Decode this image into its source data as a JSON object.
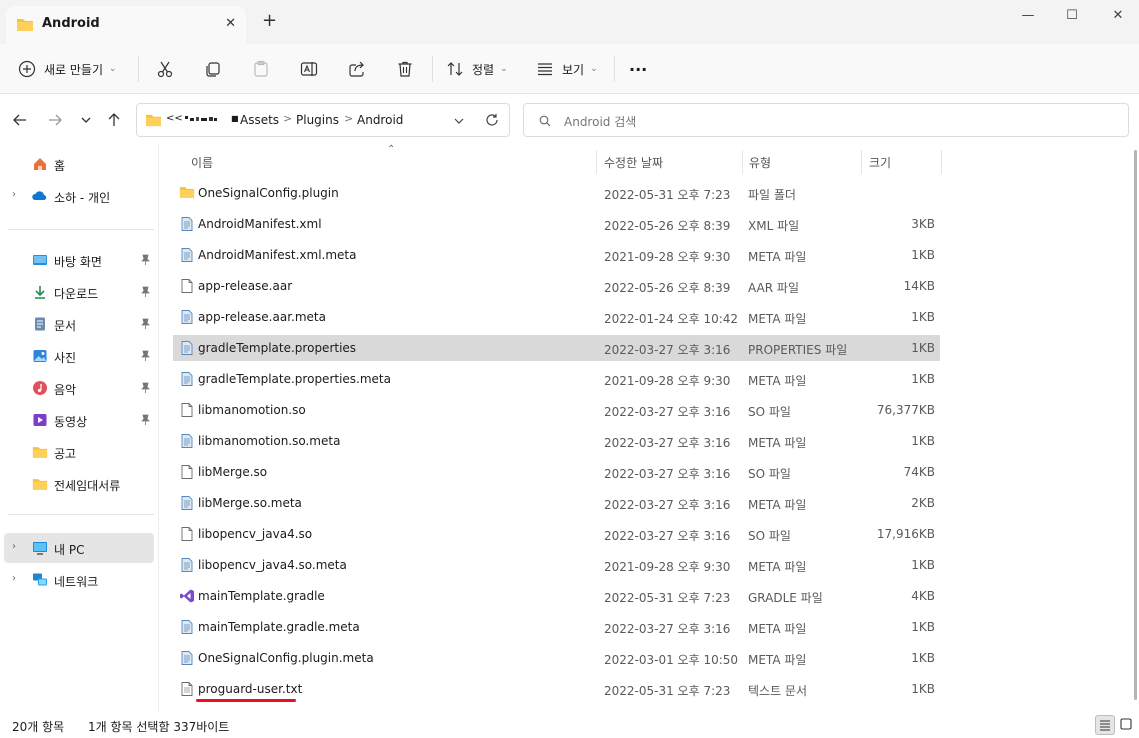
{
  "window": {
    "tab_title": "Android",
    "new_tab": "+",
    "minimize": "—",
    "maximize": "☐",
    "close": "✕",
    "tab_close": "✕"
  },
  "toolbar": {
    "new_label": "새로 만들기",
    "sort_label": "정렬",
    "view_label": "보기",
    "more": "···",
    "icons": [
      "plus-circle-icon",
      "cut-icon",
      "copy-icon",
      "paste-icon",
      "rename-icon",
      "share-icon",
      "delete-icon",
      "sort-icon",
      "view-icon"
    ]
  },
  "address": {
    "crumbs": [
      "<<",
      "Assets",
      "Plugins",
      "Android"
    ],
    "separator": ">",
    "search_placeholder": "Android 검색"
  },
  "sidebar": {
    "items": [
      {
        "label": "홈",
        "icon": "home-icon",
        "expandable": false,
        "pinned": false
      },
      {
        "label": "소하 - 개인",
        "icon": "onedrive-icon",
        "expandable": true,
        "pinned": false
      },
      {
        "label": "바탕 화면",
        "icon": "desktop-icon",
        "expandable": false,
        "pinned": true
      },
      {
        "label": "다운로드",
        "icon": "download-icon",
        "expandable": false,
        "pinned": true
      },
      {
        "label": "문서",
        "icon": "document-icon",
        "expandable": false,
        "pinned": true
      },
      {
        "label": "사진",
        "icon": "pictures-icon",
        "expandable": false,
        "pinned": true
      },
      {
        "label": "음악",
        "icon": "music-icon",
        "expandable": false,
        "pinned": true
      },
      {
        "label": "동영상",
        "icon": "video-icon",
        "expandable": false,
        "pinned": true
      },
      {
        "label": "공고",
        "icon": "folder-icon",
        "expandable": false,
        "pinned": false
      },
      {
        "label": "전세임대서류",
        "icon": "folder-icon",
        "expandable": false,
        "pinned": false
      },
      {
        "label": "내 PC",
        "icon": "pc-icon",
        "expandable": true,
        "pinned": false,
        "selected": true
      },
      {
        "label": "네트워크",
        "icon": "network-icon",
        "expandable": true,
        "pinned": false
      }
    ]
  },
  "columns": {
    "name": "이름",
    "date": "수정한 날짜",
    "type": "유형",
    "size": "크기"
  },
  "files": [
    {
      "name": "OneSignalConfig.plugin",
      "date": "2022-05-31 오후 7:23",
      "type": "파일 폴더",
      "size": "",
      "icon": "folder"
    },
    {
      "name": "AndroidManifest.xml",
      "date": "2022-05-26 오후 8:39",
      "type": "XML 파일",
      "size": "3KB",
      "icon": "textfile"
    },
    {
      "name": "AndroidManifest.xml.meta",
      "date": "2021-09-28 오후 9:30",
      "type": "META 파일",
      "size": "1KB",
      "icon": "textfile"
    },
    {
      "name": "app-release.aar",
      "date": "2022-05-26 오후 8:39",
      "type": "AAR 파일",
      "size": "14KB",
      "icon": "blank"
    },
    {
      "name": "app-release.aar.meta",
      "date": "2022-01-24 오후 10:42",
      "type": "META 파일",
      "size": "1KB",
      "icon": "textfile"
    },
    {
      "name": "gradleTemplate.properties",
      "date": "2022-03-27 오후 3:16",
      "type": "PROPERTIES 파일",
      "size": "1KB",
      "icon": "textfile",
      "selected": true
    },
    {
      "name": "gradleTemplate.properties.meta",
      "date": "2021-09-28 오후 9:30",
      "type": "META 파일",
      "size": "1KB",
      "icon": "textfile"
    },
    {
      "name": "libmanomotion.so",
      "date": "2022-03-27 오후 3:16",
      "type": "SO 파일",
      "size": "76,377KB",
      "icon": "blank"
    },
    {
      "name": "libmanomotion.so.meta",
      "date": "2022-03-27 오후 3:16",
      "type": "META 파일",
      "size": "1KB",
      "icon": "textfile"
    },
    {
      "name": "libMerge.so",
      "date": "2022-03-27 오후 3:16",
      "type": "SO 파일",
      "size": "74KB",
      "icon": "blank"
    },
    {
      "name": "libMerge.so.meta",
      "date": "2022-03-27 오후 3:16",
      "type": "META 파일",
      "size": "2KB",
      "icon": "textfile"
    },
    {
      "name": "libopencv_java4.so",
      "date": "2022-03-27 오후 3:16",
      "type": "SO 파일",
      "size": "17,916KB",
      "icon": "blank"
    },
    {
      "name": "libopencv_java4.so.meta",
      "date": "2021-09-28 오후 9:30",
      "type": "META 파일",
      "size": "1KB",
      "icon": "textfile"
    },
    {
      "name": "mainTemplate.gradle",
      "date": "2022-05-31 오후 7:23",
      "type": "GRADLE 파일",
      "size": "4KB",
      "icon": "vs"
    },
    {
      "name": "mainTemplate.gradle.meta",
      "date": "2022-03-27 오후 3:16",
      "type": "META 파일",
      "size": "1KB",
      "icon": "textfile"
    },
    {
      "name": "OneSignalConfig.plugin.meta",
      "date": "2022-03-01 오후 10:50",
      "type": "META 파일",
      "size": "1KB",
      "icon": "textfile"
    },
    {
      "name": "proguard-user.txt",
      "date": "2022-05-31 오후 7:23",
      "type": "텍스트 문서",
      "size": "1KB",
      "icon": "txt"
    }
  ],
  "status": {
    "count": "20개 항목",
    "selection": "1개 항목 선택함 337바이트"
  },
  "colors": {
    "accent": "#0067c0",
    "folder": "#f5c342",
    "selected_row": "#d9d9d9",
    "annotation": "#e81123"
  }
}
